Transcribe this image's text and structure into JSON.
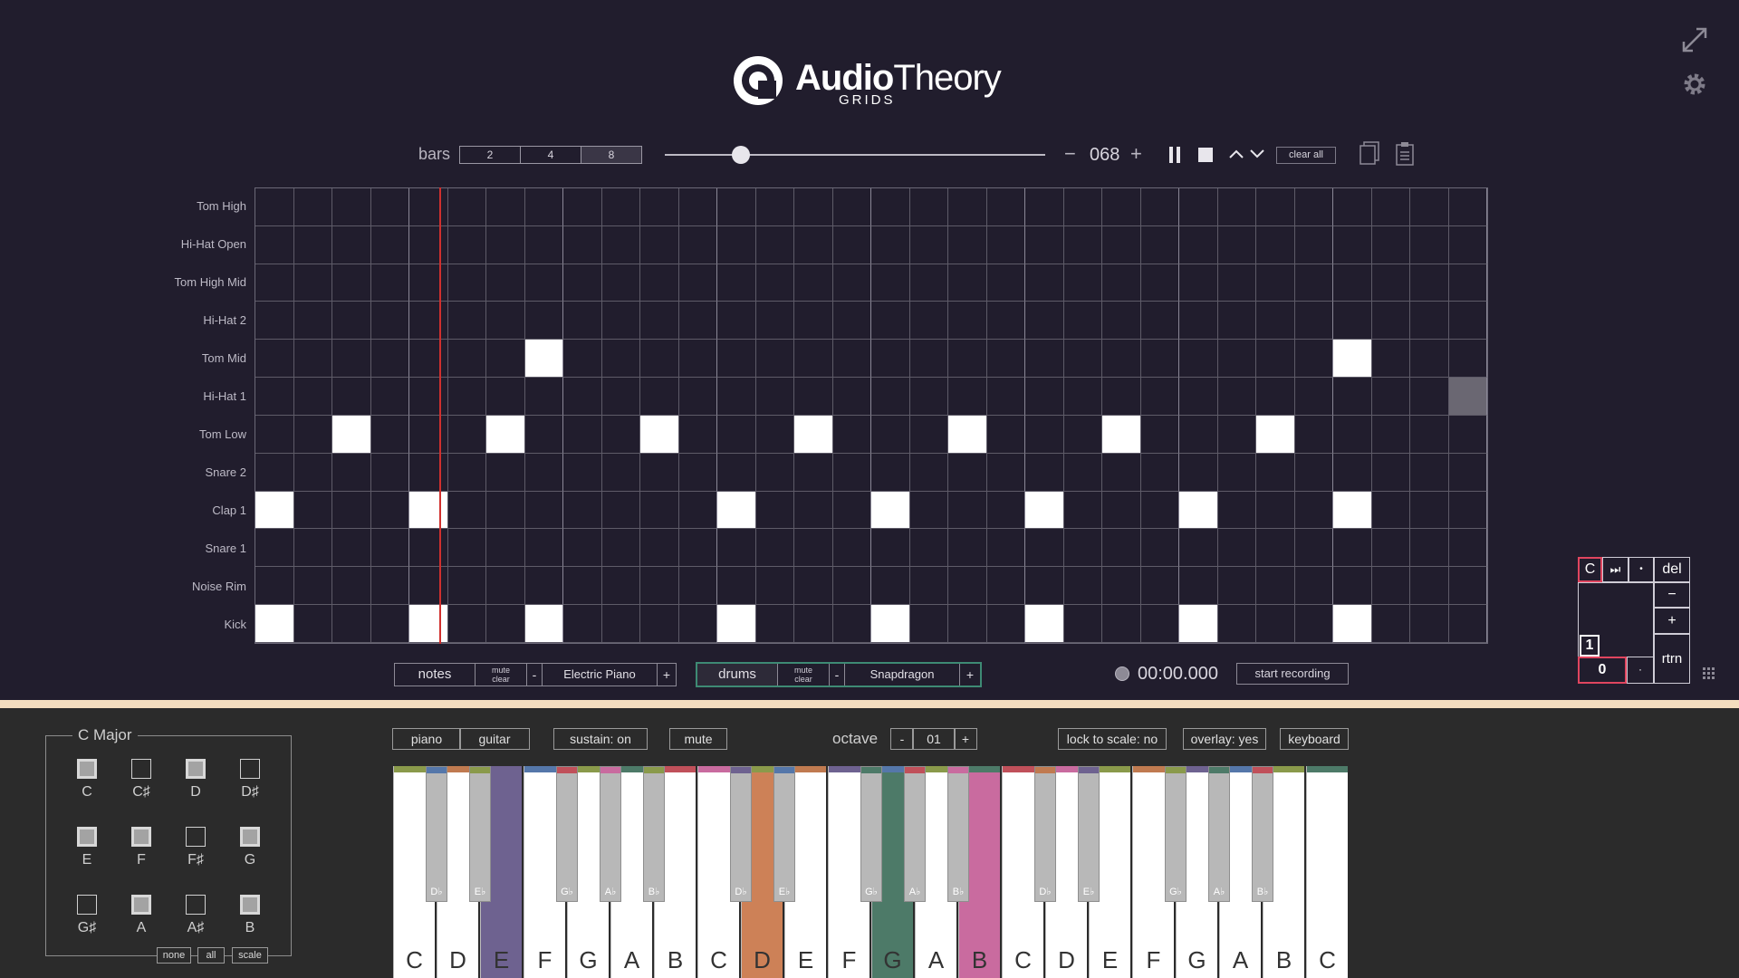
{
  "header": {
    "brand_bold": "Audio",
    "brand_light": "Theory",
    "sub": "GRIDS"
  },
  "toolbar": {
    "bars_label": "bars",
    "bars_options": [
      "2",
      "4",
      "8"
    ],
    "bars_selected": "8",
    "tempo": "068",
    "tempo_minus": "−",
    "tempo_plus": "+",
    "clear_all": "clear all",
    "tempo_slider_level": 0.2
  },
  "grid": {
    "rows": [
      "Tom High",
      "Hi-Hat Open",
      "Tom High Mid",
      "Hi-Hat 2",
      "Tom Mid",
      "Hi-Hat 1",
      "Tom Low",
      "Snare 2",
      "Clap 1",
      "Snare 1",
      "Noise Rim",
      "Kick"
    ],
    "steps": 32,
    "active_cells": [
      [
        4,
        7
      ],
      [
        4,
        28
      ],
      [
        6,
        2
      ],
      [
        6,
        6
      ],
      [
        6,
        10
      ],
      [
        6,
        14
      ],
      [
        6,
        18
      ],
      [
        6,
        22
      ],
      [
        6,
        26
      ],
      [
        8,
        0
      ],
      [
        8,
        4
      ],
      [
        8,
        12
      ],
      [
        8,
        16
      ],
      [
        8,
        20
      ],
      [
        8,
        24
      ],
      [
        8,
        28
      ],
      [
        11,
        0
      ],
      [
        11,
        4
      ],
      [
        11,
        7
      ],
      [
        11,
        12
      ],
      [
        11,
        16
      ],
      [
        11,
        20
      ],
      [
        11,
        24
      ],
      [
        11,
        28
      ]
    ],
    "selected_cell": [
      5,
      31
    ],
    "playhead_step": 4.8
  },
  "tracks": {
    "notes": {
      "name": "notes",
      "mute": "mute",
      "clear": "clear",
      "minus": "-",
      "instrument": "Electric Piano",
      "plus": "+"
    },
    "drums": {
      "name": "drums",
      "mute": "mute",
      "clear": "clear",
      "minus": "-",
      "instrument": "Snapdragon",
      "plus": "+"
    }
  },
  "recording": {
    "time": "00:00.000",
    "start_label": "start recording"
  },
  "pad": {
    "key": "C",
    "skip": "⏭",
    "dot": "•",
    "del": "del",
    "minus": "−",
    "plus": "+",
    "num1": "1",
    "num0": "0",
    "dot2": "·",
    "rtrn": "rtrn"
  },
  "scale": {
    "title": "C Major",
    "notes": [
      {
        "name": "C",
        "on": true
      },
      {
        "name": "C♯",
        "on": false
      },
      {
        "name": "D",
        "on": true
      },
      {
        "name": "D♯",
        "on": false
      },
      {
        "name": "E",
        "on": true
      },
      {
        "name": "F",
        "on": true
      },
      {
        "name": "F♯",
        "on": false
      },
      {
        "name": "G",
        "on": true
      },
      {
        "name": "G♯",
        "on": false
      },
      {
        "name": "A",
        "on": true
      },
      {
        "name": "A♯",
        "on": false
      },
      {
        "name": "B",
        "on": true
      }
    ],
    "buttons": {
      "none": "none",
      "all": "all",
      "scale": "scale"
    }
  },
  "keyboard_options": {
    "piano": "piano",
    "guitar": "guitar",
    "sustain": "sustain: on",
    "mute": "mute",
    "octave_label": "octave",
    "octave_minus": "-",
    "octave_value": "01",
    "octave_plus": "+",
    "lock": "lock to scale: no",
    "overlay": "overlay: yes",
    "keyboard": "keyboard"
  },
  "piano": {
    "white_keys": [
      "C",
      "D",
      "E",
      "F",
      "G",
      "A",
      "B",
      "C",
      "D",
      "E",
      "F",
      "G",
      "A",
      "B",
      "C",
      "D",
      "E",
      "F",
      "G",
      "A",
      "B",
      "C"
    ],
    "black_keys": [
      "D♭",
      "E♭",
      "G♭",
      "A♭",
      "B♭",
      "D♭",
      "E♭",
      "G♭",
      "A♭",
      "B♭",
      "D♭",
      "E♭",
      "G♭",
      "A♭",
      "B♭"
    ],
    "highlighted": [
      {
        "white_index": 2,
        "color": "#6e6290"
      },
      {
        "white_index": 8,
        "color": "#cd8157"
      },
      {
        "white_index": 11,
        "color": "#4d7a68"
      },
      {
        "white_index": 13,
        "color": "#c96b9f"
      }
    ],
    "strip_colors": [
      "#8a9a4b",
      "#c07a50",
      "#6e6290",
      "#5577aa",
      "#8a9a4b",
      "#4d7a68",
      "#c0505a",
      "#c96b9f"
    ]
  },
  "colors": {
    "background": "#211d2d",
    "accent_pink": "#e0455f",
    "active_track": "#3e8a74",
    "playhead": "#d0302e",
    "divider": "#f3ddbf"
  }
}
